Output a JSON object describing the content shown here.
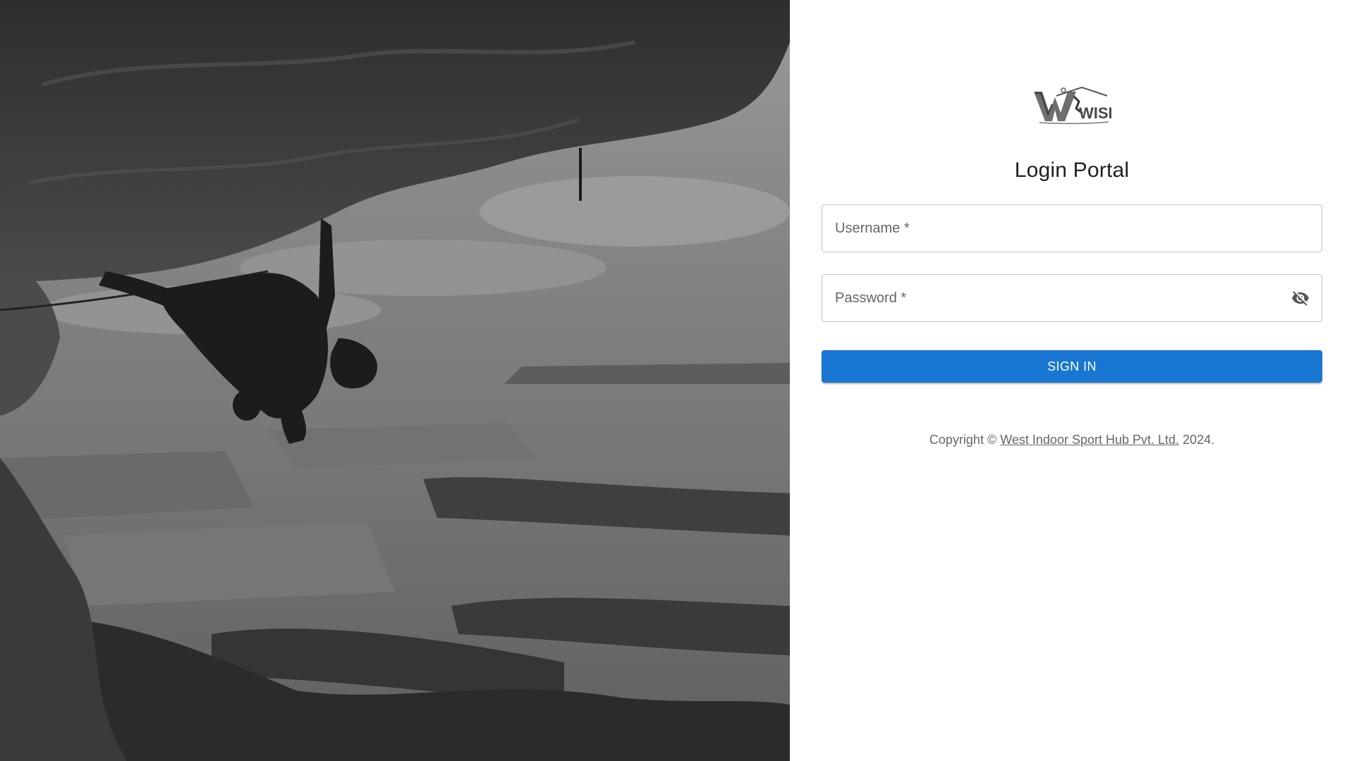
{
  "login": {
    "title": "Login Portal",
    "username": {
      "placeholder": "Username *",
      "value": ""
    },
    "password": {
      "placeholder": "Password *",
      "value": "",
      "visibility_icon": "visibility-off-icon"
    },
    "signin_label": "SIGN IN"
  },
  "brand": {
    "logo_icon": "wish-logo",
    "logo_text": "WISH",
    "accent_color": "#1976d2"
  },
  "footer": {
    "prefix": "Copyright ©",
    "company": "West Indoor Sport Hub Pvt. Ltd.",
    "suffix": "2024."
  },
  "hero": {
    "image_icon": "rock-climber-photo"
  }
}
